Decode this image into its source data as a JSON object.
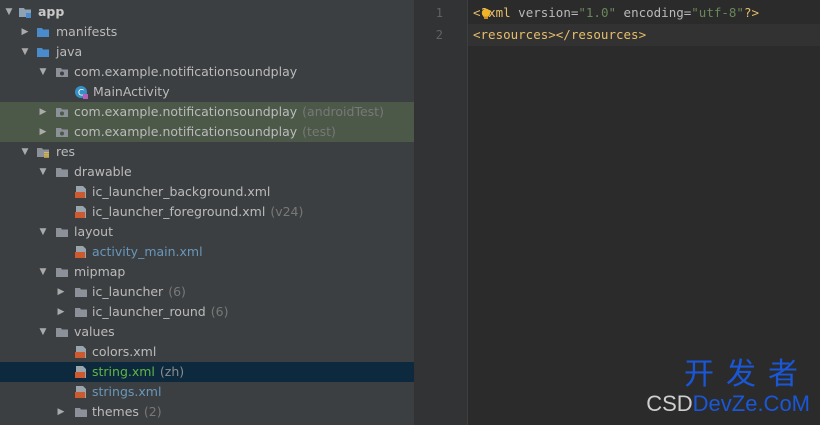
{
  "tree": {
    "rows": [
      {
        "label": "app",
        "chev": "open",
        "icon": "module-folder-icon"
      },
      {
        "label": "manifests",
        "chev": "closed",
        "icon": "folder-blue-icon"
      },
      {
        "label": "java",
        "chev": "open",
        "icon": "folder-blue-icon"
      },
      {
        "label": "com.example.notificationsoundplay",
        "chev": "open",
        "icon": "package-icon"
      },
      {
        "label": "MainActivity",
        "chev": "none",
        "icon": "kotlin-class-icon"
      },
      {
        "label": "com.example.notificationsoundplay",
        "suffix": "(androidTest)",
        "chev": "closed",
        "icon": "package-icon"
      },
      {
        "label": "com.example.notificationsoundplay",
        "suffix": "(test)",
        "chev": "closed",
        "icon": "package-icon"
      },
      {
        "label": "res",
        "chev": "open",
        "icon": "res-folder-icon"
      },
      {
        "label": "drawable",
        "chev": "open",
        "icon": "folder-icon"
      },
      {
        "label": "ic_launcher_background.xml",
        "chev": "none",
        "icon": "xml-file-icon"
      },
      {
        "label": "ic_launcher_foreground.xml",
        "suffix": "(v24)",
        "chev": "none",
        "icon": "xml-file-icon"
      },
      {
        "label": "layout",
        "chev": "open",
        "icon": "folder-icon"
      },
      {
        "label": "activity_main.xml",
        "chev": "none",
        "icon": "xml-file-icon"
      },
      {
        "label": "mipmap",
        "chev": "open",
        "icon": "folder-icon"
      },
      {
        "label": "ic_launcher",
        "suffix": "(6)",
        "chev": "closed",
        "icon": "folder-icon"
      },
      {
        "label": "ic_launcher_round",
        "suffix": "(6)",
        "chev": "closed",
        "icon": "folder-icon"
      },
      {
        "label": "values",
        "chev": "open",
        "icon": "folder-icon"
      },
      {
        "label": "colors.xml",
        "chev": "none",
        "icon": "xml-file-icon"
      },
      {
        "label": "string.xml",
        "suffix": "(zh)",
        "chev": "none",
        "icon": "xml-file-icon"
      },
      {
        "label": "strings.xml",
        "chev": "none",
        "icon": "xml-file-icon"
      },
      {
        "label": "themes",
        "suffix": "(2)",
        "chev": "closed",
        "icon": "folder-icon"
      }
    ]
  },
  "editor": {
    "line_numbers": [
      "1",
      "2"
    ],
    "line1": {
      "open": "<?",
      "tagname": "xml",
      "attr1": " version=",
      "val1": "\"1.0\"",
      "attr2": " encoding=",
      "val2": "\"utf-8\"",
      "close": "?>"
    },
    "line2": "<resources></resources>"
  },
  "watermark": {
    "cn": "开发者",
    "csd": "CSD",
    "devze": "DevZe.CoM"
  },
  "colors": {
    "tree_bg": "#3c3f41",
    "editor_bg": "#2b2b2b",
    "highlight_green": "#4c5848",
    "selected_row": "#0d293e",
    "modified_blue": "#6897bb",
    "modified_green": "#62b543",
    "xml_tag": "#e8bf6a",
    "xml_string": "#6a8759"
  }
}
